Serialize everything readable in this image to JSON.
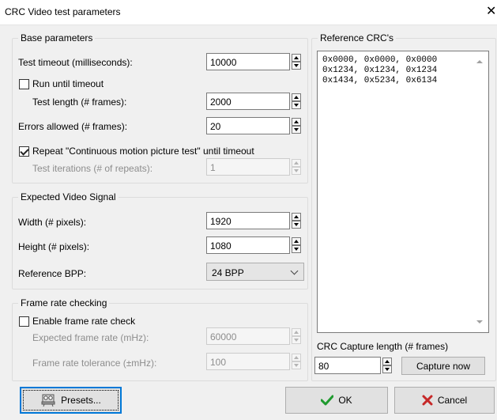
{
  "window": {
    "title": "CRC Video test parameters",
    "close_glyph": "✕"
  },
  "base": {
    "legend": "Base parameters",
    "timeout_label": "Test timeout (milliseconds):",
    "timeout_value": "10000",
    "run_until_timeout_label": "Run until timeout",
    "run_until_timeout_checked": false,
    "length_label": "Test length (# frames):",
    "length_value": "2000",
    "errors_label": "Errors allowed (# frames):",
    "errors_value": "20",
    "repeat_label": "Repeat \"Continuous motion picture test\" until timeout",
    "repeat_checked": true,
    "iterations_label": "Test iterations (# of repeats):",
    "iterations_value": "1"
  },
  "signal": {
    "legend": "Expected Video Signal",
    "width_label": "Width (# pixels):",
    "width_value": "1920",
    "height_label": "Height (# pixels):",
    "height_value": "1080",
    "bpp_label": "Reference BPP:",
    "bpp_value": "24 BPP"
  },
  "framerate": {
    "legend": "Frame rate checking",
    "enable_label": "Enable frame rate check",
    "enable_checked": false,
    "expected_label": "Expected frame rate (mHz):",
    "expected_value": "60000",
    "tolerance_label": "Frame rate tolerance (±mHz):",
    "tolerance_value": "100"
  },
  "reference": {
    "legend": "Reference CRC's",
    "lines": [
      "0x0000, 0x0000, 0x0000",
      "0x1234, 0x1234, 0x1234",
      "0x1434, 0x5234, 0x6134"
    ],
    "capture_length_label": "CRC Capture length (# frames)",
    "capture_length_value": "80",
    "capture_now_label": "Capture now"
  },
  "buttons": {
    "presets_label": "Presets...",
    "ok_label": "OK",
    "cancel_label": "Cancel"
  },
  "colors": {
    "ok_check": "#1f9a2e",
    "cancel_x": "#c62828",
    "focus_border": "#0078d7"
  }
}
